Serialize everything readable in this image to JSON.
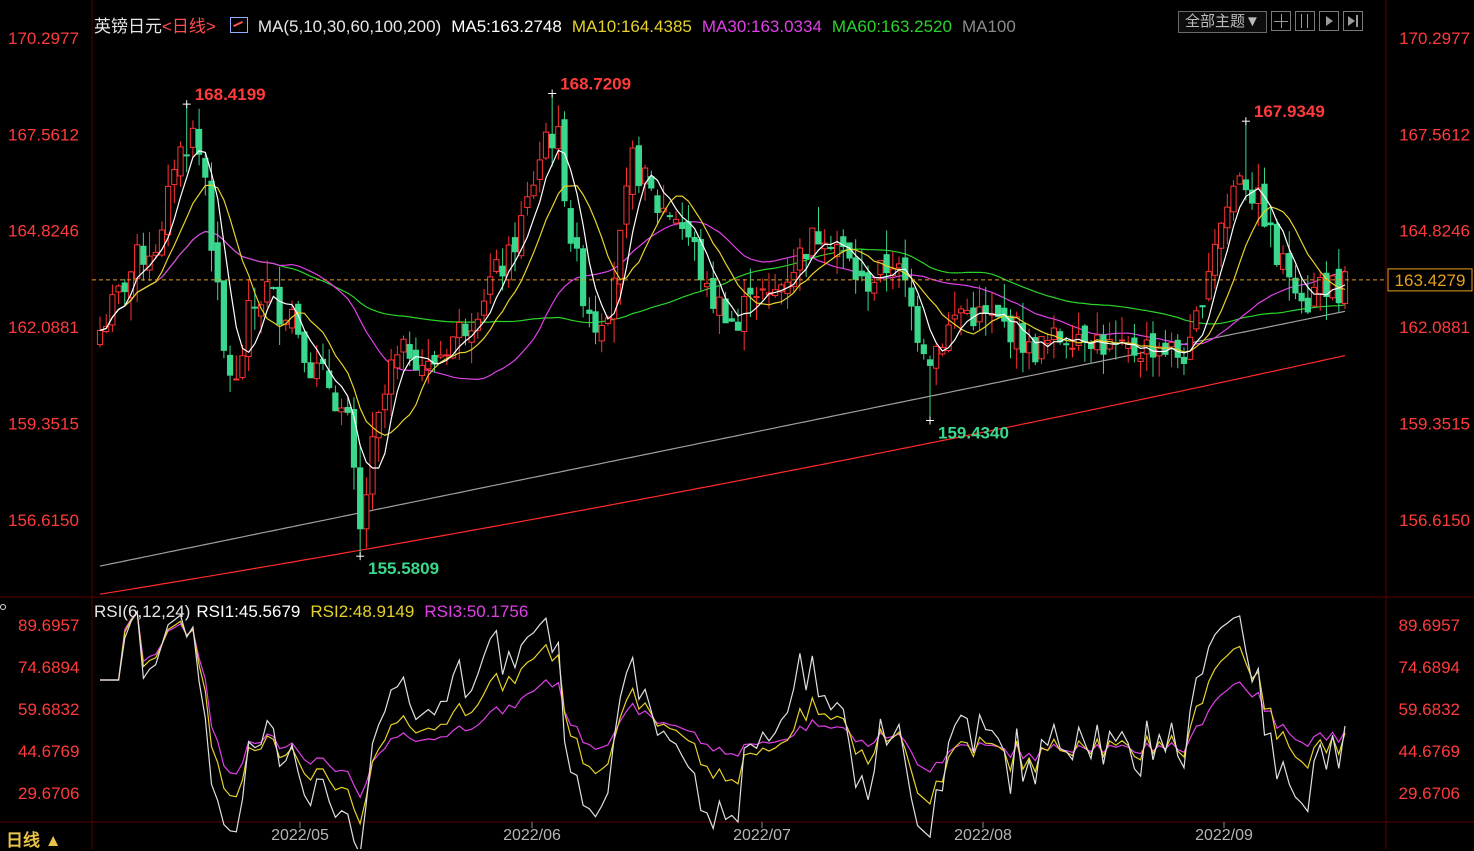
{
  "header": {
    "symbol": "英镑日元",
    "period_link": "<日线>",
    "ma_label": "MA(5,10,30,60,100,200)",
    "ma5": "MA5:163.2748",
    "ma10": "MA10:164.4385",
    "ma30": "MA30:163.0334",
    "ma60": "MA60:163.2520",
    "ma100": "MA100",
    "theme_button": "全部主题▼"
  },
  "rsi_header": {
    "label": "RSI(6,12,24)",
    "rsi1": "RSI1:45.5679",
    "rsi2": "RSI2:48.9149",
    "rsi3": "RSI3:50.1756"
  },
  "footer": {
    "period": "日线 ▲"
  },
  "colors": {
    "up": "#ff3232",
    "down": "#3ad88d",
    "ma5": "#ffffff",
    "ma10": "#e6d22a",
    "ma30": "#e040e8",
    "ma60": "#2ad42a",
    "ma100": "#a0a0a0",
    "ma200": "#ff2a2a",
    "axis_text": "#ff3b3b",
    "grid": "#2a2a2a"
  },
  "chart_data": [
    {
      "type": "candlestick",
      "ylim": [
        154.45,
        170.2977
      ],
      "y_ticks": [
        "170.2977",
        "167.5612",
        "164.8246",
        "162.0881",
        "159.3515",
        "156.6150"
      ],
      "x_ticks": [
        "2022/05",
        "2022/06",
        "2022/07",
        "2022/08",
        "2022/09"
      ],
      "last_price": "163.4279",
      "annotations": [
        {
          "label": "168.4199",
          "value": 168.4199,
          "kind": "high"
        },
        {
          "label": "155.5809",
          "value": 155.5809,
          "kind": "low"
        },
        {
          "label": "168.7209",
          "value": 168.7209,
          "kind": "high"
        },
        {
          "label": "159.4340",
          "value": 159.434,
          "kind": "low"
        },
        {
          "label": "167.9349",
          "value": 167.9349,
          "kind": "high"
        }
      ],
      "series": [
        {
          "name": "MA5",
          "value": 163.2748
        },
        {
          "name": "MA10",
          "value": 164.4385
        },
        {
          "name": "MA30",
          "value": 163.0334
        },
        {
          "name": "MA60",
          "value": 163.252
        },
        {
          "name": "MA100"
        }
      ]
    },
    {
      "type": "line",
      "ylim": [
        20.0,
        95.0
      ],
      "y_ticks": [
        "89.6957",
        "74.6894",
        "59.6832",
        "44.6769",
        "29.6706"
      ],
      "series": [
        {
          "name": "RSI1",
          "value": 45.5679
        },
        {
          "name": "RSI2",
          "value": 48.9149
        },
        {
          "name": "RSI3",
          "value": 50.1756
        }
      ]
    }
  ]
}
